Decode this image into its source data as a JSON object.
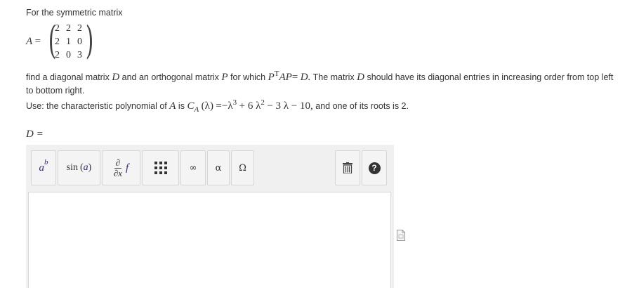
{
  "intro": "For the symmetric matrix",
  "matrix": {
    "name": "A",
    "equals": "=",
    "rows": [
      [
        "2",
        "2",
        "2"
      ],
      [
        "2",
        "1",
        "0"
      ],
      [
        "2",
        "0",
        "3"
      ]
    ]
  },
  "find": {
    "part1": "find a diagonal matrix",
    "var_D": "D",
    "part2": "and an orthogonal matrix",
    "var_P": "P",
    "part3": "for which",
    "eq_lhs_P": "P",
    "eq_sup": "T",
    "eq_AP": "AP",
    "eq_equals": "=",
    "eq_D": "D.",
    "part4": "The matrix",
    "var_D2": "D",
    "part5": "should have its diagonal entries in increasing order from top left to bottom right."
  },
  "use": {
    "prefix": "Use:  the characteristic polynomial of",
    "var_A": "A",
    "is": "is",
    "C": "C",
    "C_sub": "A",
    "lambda_arg": "(λ)",
    "eq": "=",
    "term1": "−λ",
    "exp3": "3",
    "term2": "+ 6 λ",
    "exp2": "2",
    "term3": "− 3 λ − 10,",
    "suffix": "and one of its roots is 2."
  },
  "answer_label": "D =",
  "toolbar": {
    "superscript_base": "a",
    "superscript_exp": "b",
    "sin_label": "sin",
    "sin_arg": "a",
    "deriv_num": "∂",
    "deriv_den": "∂x",
    "deriv_f": "f",
    "infinity": "∞",
    "alpha": "α",
    "omega": "Ω",
    "help": "?"
  },
  "icons": {
    "matrix": "matrix-grid-icon",
    "trash": "trash-icon",
    "help": "help-icon",
    "file": "file-icon"
  }
}
